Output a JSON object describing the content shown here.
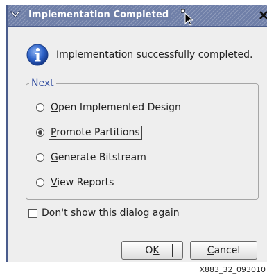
{
  "dialog": {
    "title": "Implementation Completed",
    "message": "Implementation successfully completed.",
    "group_label": "Next",
    "options": [
      {
        "pre": "",
        "mnemonic": "O",
        "post": "pen Implemented Design",
        "checked": false,
        "focused": false
      },
      {
        "pre": "",
        "mnemonic": "P",
        "post": "romote Partitions",
        "checked": true,
        "focused": true
      },
      {
        "pre": "",
        "mnemonic": "G",
        "post": "enerate Bitstream",
        "checked": false,
        "focused": false
      },
      {
        "pre": "",
        "mnemonic": "V",
        "post": "iew Reports",
        "checked": false,
        "focused": false
      }
    ],
    "dont_show": {
      "mnemonic": "D",
      "post": "on't show this dialog again",
      "checked": false
    },
    "ok": {
      "pre": "O",
      "mnemonic": "K"
    },
    "cancel": {
      "mnemonic": "C",
      "post": "ancel"
    }
  },
  "footnote": "X883_32_093010",
  "colors": {
    "titlebar": "#6f7fa8",
    "accent": "#3a54a4",
    "info_icon": "#2e63c9"
  },
  "icons": [
    "chevron-down-icon",
    "close-icon",
    "mouse-cursor-icon",
    "info-icon"
  ]
}
